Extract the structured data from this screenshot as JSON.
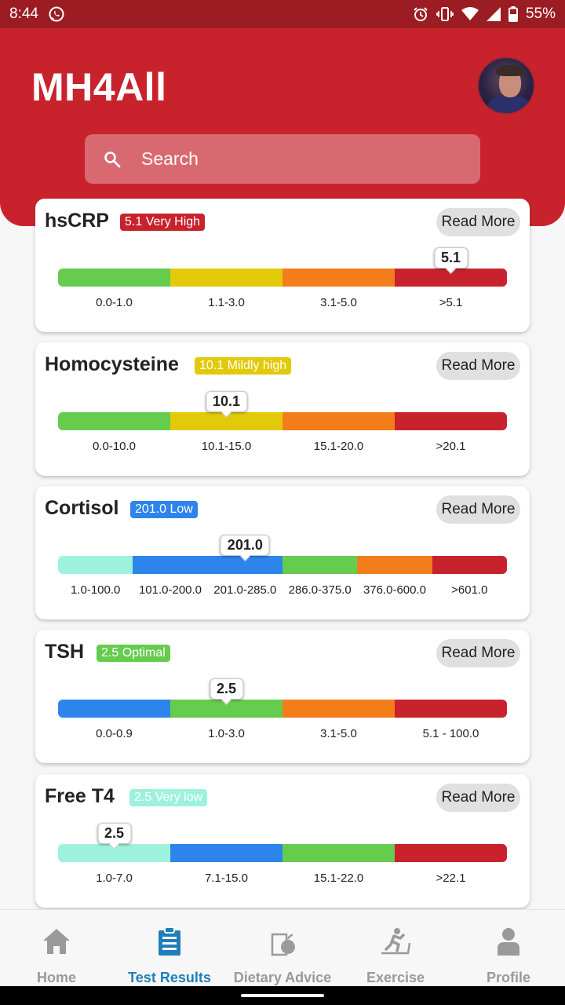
{
  "status_bar": {
    "time": "8:44",
    "battery": "55%",
    "icons": [
      "whatsapp-icon",
      "alarm-icon",
      "vibrate-icon",
      "wifi-icon",
      "signal-icon",
      "battery-icon"
    ]
  },
  "header": {
    "title": "MH4All",
    "search_placeholder": "Search"
  },
  "cards": [
    {
      "name": "hsCRP",
      "badge": "5.1 Very High",
      "badge_color": "#c8232d",
      "badge_text_color": "#ffffff",
      "value": "5.1",
      "read_more": "Read More",
      "segments": [
        {
          "range": "0.0-1.0",
          "color": "#66cc4e"
        },
        {
          "range": "1.1-3.0",
          "color": "#e2ca0a"
        },
        {
          "range": "3.1-5.0",
          "color": "#f47d1b"
        },
        {
          "range": ">5.1",
          "color": "#c8232d"
        }
      ],
      "marker_segment": 3
    },
    {
      "name": "Homocysteine",
      "badge": "10.1 Mildly high",
      "badge_color": "#e2ca0a",
      "badge_text_color": "#ffffff",
      "value": "10.1",
      "read_more": "Read More",
      "segments": [
        {
          "range": "0.0-10.0",
          "color": "#66cc4e"
        },
        {
          "range": "10.1-15.0",
          "color": "#e2ca0a"
        },
        {
          "range": "15.1-20.0",
          "color": "#f47d1b"
        },
        {
          "range": ">20.1",
          "color": "#c8232d"
        }
      ],
      "marker_segment": 1
    },
    {
      "name": "Cortisol",
      "badge": "201.0 Low",
      "badge_color": "#2d84ea",
      "badge_text_color": "#ffffff",
      "value": "201.0",
      "read_more": "Read More",
      "segments": [
        {
          "range": "1.0-100.0",
          "color": "#9ef2dd"
        },
        {
          "range": "101.0-200.0",
          "color": "#2d84ea"
        },
        {
          "range": "201.0-285.0",
          "color": "#2d84ea"
        },
        {
          "range": "286.0-375.0",
          "color": "#66cc4e"
        },
        {
          "range": "376.0-600.0",
          "color": "#f47d1b"
        },
        {
          "range": ">601.0",
          "color": "#c8232d"
        }
      ],
      "marker_segment": 2
    },
    {
      "name": "TSH",
      "badge": "2.5 Optimal",
      "badge_color": "#66cc4e",
      "badge_text_color": "#ffffff",
      "value": "2.5",
      "read_more": "Read More",
      "segments": [
        {
          "range": "0.0-0.9",
          "color": "#2d84ea"
        },
        {
          "range": "1.0-3.0",
          "color": "#66cc4e"
        },
        {
          "range": "3.1-5.0",
          "color": "#f47d1b"
        },
        {
          "range": "5.1 - 100.0",
          "color": "#c8232d"
        }
      ],
      "marker_segment": 1
    },
    {
      "name": "Free T4",
      "badge": "2.5 Very low",
      "badge_color": "#9ef2dd",
      "badge_text_color": "#ffffff",
      "value": "2.5",
      "read_more": "Read More",
      "segments": [
        {
          "range": "1.0-7.0",
          "color": "#9ef2dd"
        },
        {
          "range": "7.1-15.0",
          "color": "#2d84ea"
        },
        {
          "range": "15.1-22.0",
          "color": "#66cc4e"
        },
        {
          "range": ">22.1",
          "color": "#c8232d"
        }
      ],
      "marker_segment": 0
    }
  ],
  "bottom_nav": [
    {
      "label": "Home",
      "icon": "home-icon",
      "active": false
    },
    {
      "label": "Test Results",
      "icon": "clipboard-icon",
      "active": true
    },
    {
      "label": "Dietary Advice",
      "icon": "apple-icon",
      "active": false
    },
    {
      "label": "Exercise",
      "icon": "treadmill-icon",
      "active": false
    },
    {
      "label": "Profile",
      "icon": "person-icon",
      "active": false
    }
  ],
  "colors": {
    "header_red": "#c8232d",
    "status_bar": "#9b1c22",
    "nav_active": "#1f7fb8",
    "nav_inactive": "#9a9a9a"
  }
}
